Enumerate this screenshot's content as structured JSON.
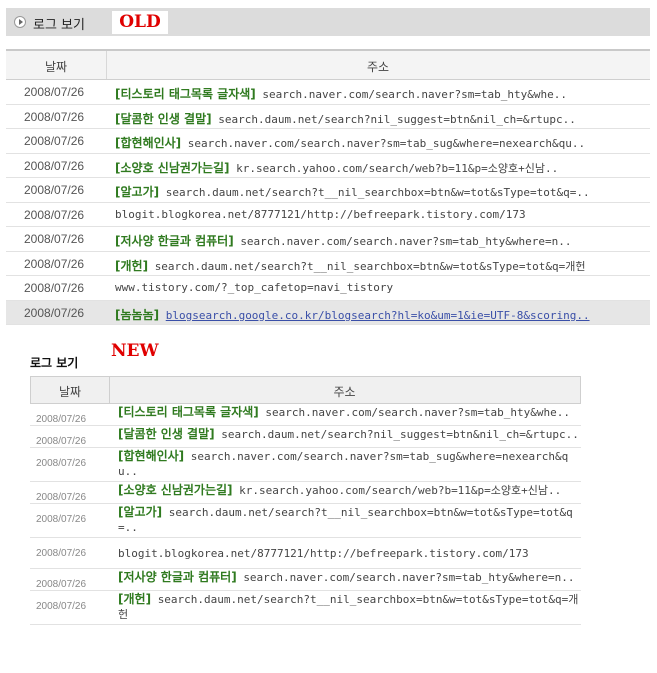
{
  "old": {
    "section_title": "로그 보기",
    "badge": "OLD",
    "header": {
      "date": "날짜",
      "address": "주소"
    },
    "rows": [
      {
        "date": "2008/07/26",
        "keyword": "[티스토리 태그목록 글자색]",
        "url": "search.naver.com/search.naver?sm=tab_hty&whe.."
      },
      {
        "date": "2008/07/26",
        "keyword": "[달콤한 인생 결말]",
        "url": "search.daum.net/search?nil_suggest=btn&nil_ch=&rtupc.."
      },
      {
        "date": "2008/07/26",
        "keyword": "[합현해인사]",
        "url": "search.naver.com/search.naver?sm=tab_sug&where=nexearch&qu.."
      },
      {
        "date": "2008/07/26",
        "keyword": "[소양호 신남권가는길]",
        "url": "kr.search.yahoo.com/search/web?b=11&p=소양호+신남.."
      },
      {
        "date": "2008/07/26",
        "keyword": "[알고가]",
        "url": "search.daum.net/search?t__nil_searchbox=btn&w=tot&sType=tot&q=.."
      },
      {
        "date": "2008/07/26",
        "keyword": "",
        "url": "blogit.blogkorea.net/8777121/http://befreepark.tistory.com/173"
      },
      {
        "date": "2008/07/26",
        "keyword": "[저사양 한글과 컴퓨터]",
        "url": "search.naver.com/search.naver?sm=tab_hty&where=n.."
      },
      {
        "date": "2008/07/26",
        "keyword": "[개헌]",
        "url": "search.daum.net/search?t__nil_searchbox=btn&w=tot&sType=tot&q=개헌"
      },
      {
        "date": "2008/07/26",
        "keyword": "",
        "url": "www.tistory.com/?_top_cafetop=navi_tistory"
      },
      {
        "date": "2008/07/26",
        "keyword": "[놈놈놈]",
        "url": "blogsearch.google.co.kr/blogsearch?hl=ko&um=1&ie=UTF-8&scoring.."
      }
    ]
  },
  "new": {
    "section_title": "로그 보기",
    "badge": "NEW",
    "header": {
      "date": "날짜",
      "address": "주소"
    },
    "rows": [
      {
        "date": "2008/07/26",
        "keyword": "[티스토리 태그목록 글자색]",
        "url": "search.naver.com/search.naver?sm=tab_hty&whe.."
      },
      {
        "date": "2008/07/26",
        "keyword": "[달콤한 인생 결말]",
        "url": "search.daum.net/search?nil_suggest=btn&nil_ch=&rtupc.."
      },
      {
        "date": "2008/07/26",
        "keyword": "[합현해인사]",
        "url": "search.naver.com/search.naver?sm=tab_sug&where=nexearch&qu.."
      },
      {
        "date": "2008/07/26",
        "keyword": "[소양호 신남권가는길]",
        "url": "kr.search.yahoo.com/search/web?b=11&p=소양호+신남.."
      },
      {
        "date": "2008/07/26",
        "keyword": "[알고가]",
        "url": "search.daum.net/search?t__nil_searchbox=btn&w=tot&sType=tot&q=.."
      },
      {
        "date": "2008/07/26",
        "keyword": "",
        "url": "blogit.blogkorea.net/8777121/http://befreepark.tistory.com/173"
      },
      {
        "date": "2008/07/26",
        "keyword": "[저사양 한글과 컴퓨터]",
        "url": "search.naver.com/search.naver?sm=tab_hty&where=n.."
      },
      {
        "date": "2008/07/26",
        "keyword": "[개헌]",
        "url": "search.daum.net/search?t__nil_searchbox=btn&w=tot&sType=tot&q=개헌"
      }
    ]
  }
}
